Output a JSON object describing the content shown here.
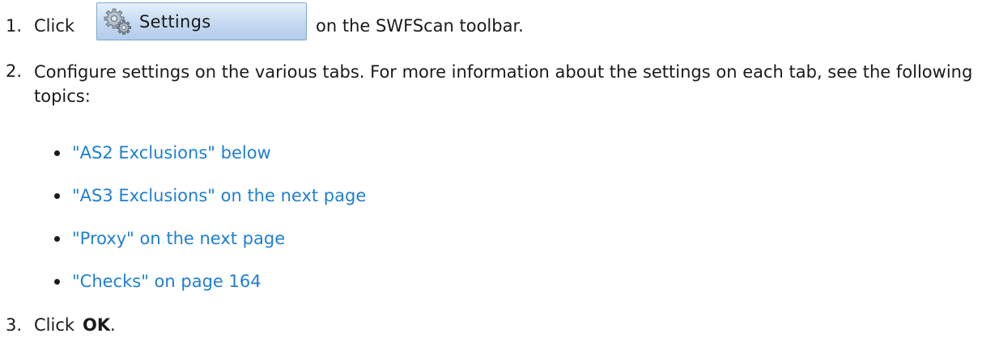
{
  "steps": [
    {
      "number": "1.",
      "before": "Click",
      "button_label": "Settings",
      "after": "on the SWFScan toolbar."
    },
    {
      "number": "2.",
      "text": "Configure settings on the various tabs. For more information about the settings on each tab, see the following topics:"
    },
    {
      "number": "3.",
      "before": "Click",
      "bold": "OK",
      "after": "."
    }
  ],
  "topics": [
    "\"AS2 Exclusions\" below",
    "\"AS3 Exclusions\" on the next page",
    "\"Proxy\" on the next page",
    "\"Checks\" on page 164"
  ],
  "colors": {
    "text": "#1a1a1a",
    "link": "#1f7fd3",
    "button_border": "#7fa7d0",
    "button_fill": "#c5d9f1"
  },
  "icons": {
    "settings_button": "gears-icon",
    "bullet": "bullet-dot"
  }
}
